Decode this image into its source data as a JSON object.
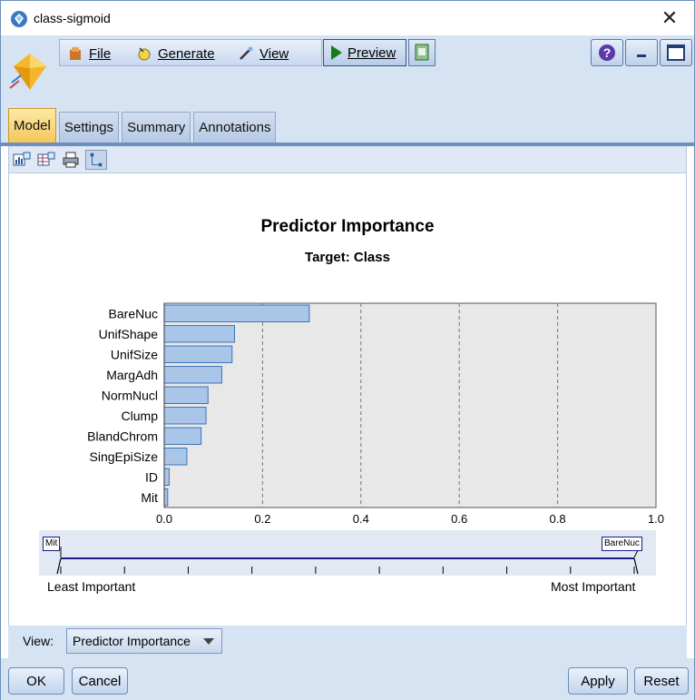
{
  "window": {
    "title": "class-sigmoid"
  },
  "menu": {
    "file": "File",
    "generate": "Generate",
    "view": "View",
    "preview": "Preview"
  },
  "tabs": [
    {
      "label": "Model",
      "active": true
    },
    {
      "label": "Settings",
      "active": false
    },
    {
      "label": "Summary",
      "active": false
    },
    {
      "label": "Annotations",
      "active": false
    }
  ],
  "chart_data": {
    "type": "bar",
    "orientation": "horizontal",
    "title": "Predictor Importance",
    "subtitle": "Target: Class",
    "categories": [
      "BareNuc",
      "UnifShape",
      "UnifSize",
      "MargAdh",
      "NormNucl",
      "Clump",
      "BlandChrom",
      "SingEpiSize",
      "ID",
      "Mit"
    ],
    "values": [
      0.295,
      0.143,
      0.138,
      0.117,
      0.089,
      0.085,
      0.075,
      0.046,
      0.01,
      0.007
    ],
    "xlim": [
      0.0,
      1.0
    ],
    "xticks": [
      "0.0",
      "0.2",
      "0.4",
      "0.6",
      "0.8",
      "1.0"
    ],
    "grid": "vertical-dashed",
    "bar_color": "#a9c6e8",
    "bar_edge": "#3b74b8"
  },
  "slider": {
    "least_label": "Mit",
    "most_label": "BareNuc",
    "least_text": "Least Important",
    "most_text": "Most Important"
  },
  "view": {
    "label": "View:",
    "selected": "Predictor Importance"
  },
  "buttons": {
    "ok": "OK",
    "cancel": "Cancel",
    "apply": "Apply",
    "reset": "Reset"
  }
}
